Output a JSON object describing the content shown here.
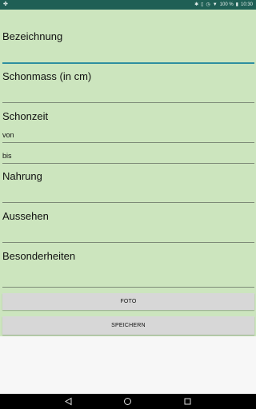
{
  "status_bar": {
    "left_icon": "notification-icon",
    "icons": [
      "bluetooth-icon",
      "vibrate-icon",
      "alarm-icon",
      "wifi-icon"
    ],
    "battery_percent": "100 %",
    "time": "10:30"
  },
  "form": {
    "bezeichnung_label": "Bezeichnung",
    "schonmass_label": "Schonmass (in cm)",
    "schonzeit_label": "Schonzeit",
    "von_label": "von",
    "bis_label": "bis",
    "nahrung_label": "Nahrung",
    "aussehen_label": "Aussehen",
    "besonderheiten_label": "Besonderheiten"
  },
  "buttons": {
    "foto_label": "FOTO",
    "speichern_label": "SPEICHERN"
  },
  "nav": {
    "back": "back-icon",
    "home": "home-icon",
    "recents": "recents-icon"
  },
  "colors": {
    "status_bar": "#1f5f55",
    "form_background": "#cce5be",
    "active_underline": "#2e8ea0",
    "button": "#d7d7d7"
  }
}
